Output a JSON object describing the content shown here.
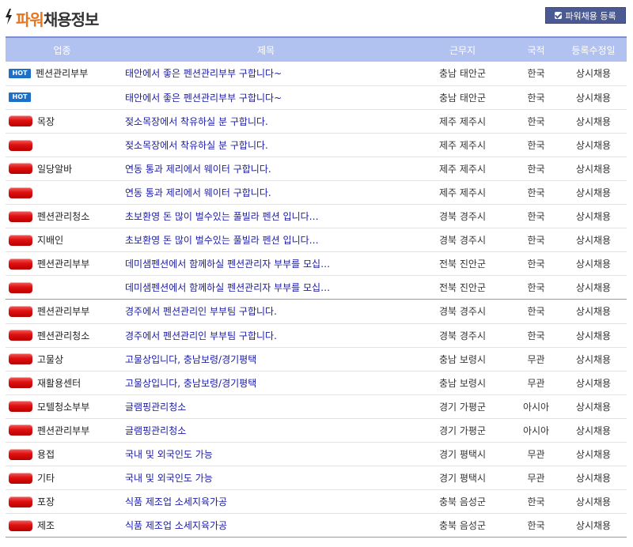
{
  "header": {
    "title_accent": "파워",
    "title_rest": "채용정보",
    "register_button": "파워채용 등록"
  },
  "columns": [
    "업종",
    "제목",
    "근무지",
    "국적",
    "등록수정일"
  ],
  "rows": [
    {
      "badge": "HOT",
      "category": "펜션관리부부",
      "title": "태안에서 좋은 펜션관리부부 구합니다~",
      "location": "충남 태안군",
      "nationality": "한국",
      "type": "상시채용"
    },
    {
      "badge": "HOT",
      "category": "",
      "title": "태안에서 좋은 펜션관리부부 구합니다~",
      "location": "충남 태안군",
      "nationality": "한국",
      "type": "상시채용"
    },
    {
      "badge": "red",
      "category": "목장",
      "title": "젖소목장에서 착유하실 분 구합니다.",
      "location": "제주 제주시",
      "nationality": "한국",
      "type": "상시채용"
    },
    {
      "badge": "red",
      "category": "",
      "title": "젖소목장에서 착유하실 분 구합니다.",
      "location": "제주 제주시",
      "nationality": "한국",
      "type": "상시채용"
    },
    {
      "badge": "red",
      "category": "일당알바",
      "title": "연동 통과 제리에서 웨이터 구합니다.",
      "location": "제주 제주시",
      "nationality": "한국",
      "type": "상시채용"
    },
    {
      "badge": "red",
      "category": "",
      "title": "연동 통과 제리에서 웨이터 구합니다.",
      "location": "제주 제주시",
      "nationality": "한국",
      "type": "상시채용"
    },
    {
      "badge": "red",
      "category": "펜션관리청소",
      "title": "초보환영 돈 많이 벌수있는 풀빌라 펜션 입니다…",
      "location": "경북 경주시",
      "nationality": "한국",
      "type": "상시채용"
    },
    {
      "badge": "red",
      "category": "지배인",
      "title": "초보환영 돈 많이 벌수있는 풀빌라 펜션 입니다…",
      "location": "경북 경주시",
      "nationality": "한국",
      "type": "상시채용"
    },
    {
      "badge": "red",
      "category": "펜션관리부부",
      "title": "데미샘펜션에서 함께하실 펜션관리자 부부를 모십…",
      "location": "전북 진안군",
      "nationality": "한국",
      "type": "상시채용"
    },
    {
      "badge": "red",
      "category": "",
      "title": "데미샘펜션에서 함께하실 펜션관리자 부부를 모십…",
      "location": "전북 진안군",
      "nationality": "한국",
      "type": "상시채용"
    },
    {
      "badge": "red",
      "category": "펜션관리부부",
      "title": "경주에서 펜션관리인 부부팀 구합니다.",
      "location": "경북 경주시",
      "nationality": "한국",
      "type": "상시채용"
    },
    {
      "badge": "red",
      "category": "펜션관리청소",
      "title": "경주에서 펜션관리인 부부팀 구합니다.",
      "location": "경북 경주시",
      "nationality": "한국",
      "type": "상시채용"
    },
    {
      "badge": "red",
      "category": "고물상",
      "title": "고물상입니다, 충남보령/경기평택",
      "location": "충남 보령시",
      "nationality": "무관",
      "type": "상시채용"
    },
    {
      "badge": "red",
      "category": "재활용센터",
      "title": "고물상입니다, 충남보령/경기평택",
      "location": "충남 보령시",
      "nationality": "무관",
      "type": "상시채용"
    },
    {
      "badge": "red",
      "category": "모텔청소부부",
      "title": "글램핑관리청소",
      "location": "경기 가평군",
      "nationality": "아시아",
      "type": "상시채용"
    },
    {
      "badge": "red",
      "category": "펜션관리부부",
      "title": "글램핑관리청소",
      "location": "경기 가평군",
      "nationality": "아시아",
      "type": "상시채용"
    },
    {
      "badge": "red",
      "category": "용접",
      "title": "국내 및 외국인도 가능",
      "location": "경기 평택시",
      "nationality": "무관",
      "type": "상시채용"
    },
    {
      "badge": "red",
      "category": "기타",
      "title": "국내 및 외국인도 가능",
      "location": "경기 평택시",
      "nationality": "무관",
      "type": "상시채용"
    },
    {
      "badge": "red",
      "category": "포장",
      "title": "식품 제조업 소세지육가공",
      "location": "충북 음성군",
      "nationality": "한국",
      "type": "상시채용"
    },
    {
      "badge": "red",
      "category": "제조",
      "title": "식품 제조업 소세지육가공",
      "location": "충북 음성군",
      "nationality": "한국",
      "type": "상시채용"
    }
  ]
}
